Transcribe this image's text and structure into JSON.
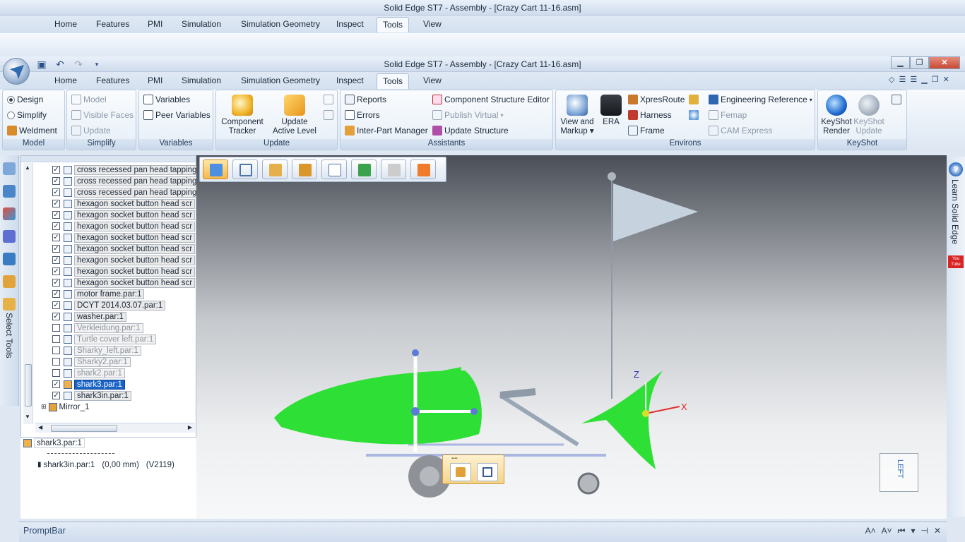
{
  "app": {
    "title": "Solid Edge ST7 - Assembly - [Crazy Cart 11-16.asm]"
  },
  "window_controls": {
    "minimize": "▁",
    "restore": "❐",
    "close": "✕"
  },
  "tabs": [
    "Home",
    "Features",
    "PMI",
    "Simulation",
    "Simulation Geometry",
    "Inspect",
    "Tools",
    "View"
  ],
  "active_tab": "Tools",
  "ribbon": {
    "model": {
      "label": "Model",
      "design": "Design",
      "simplify": "Simplify",
      "weldment": "Weldment"
    },
    "simplify": {
      "label": "Simplify",
      "model": "Model",
      "visible_faces": "Visible Faces",
      "update": "Update"
    },
    "variables": {
      "label": "Variables",
      "variables": "Variables",
      "peer_variables": "Peer Variables"
    },
    "update": {
      "label": "Update",
      "component_tracker": [
        "Component",
        "Tracker"
      ],
      "update_active_level": [
        "Update",
        "Active Level"
      ]
    },
    "assistants": {
      "label": "Assistants",
      "reports": "Reports",
      "errors": "Errors",
      "inter_part_manager": "Inter-Part Manager",
      "component_structure_editor": "Component Structure Editor",
      "publish_virtual": "Publish Virtual",
      "update_structure": "Update Structure"
    },
    "environs": {
      "label": "Environs",
      "view_and_markup": [
        "View and",
        "Markup"
      ],
      "era": "ERA",
      "xpresroute": "XpresRoute",
      "harness": "Harness",
      "frame": "Frame",
      "engineering_reference": "Engineering Reference",
      "femap": "Femap",
      "cam_express": "CAM Express"
    },
    "keyshot": {
      "label": "KeyShot",
      "render": [
        "KeyShot",
        "Render"
      ],
      "update": [
        "KeyShot",
        "Update"
      ]
    }
  },
  "pathfinder": {
    "items": [
      {
        "label": "cross recessed pan head tapping",
        "checked": true,
        "style": "normal"
      },
      {
        "label": "cross recessed pan head tapping",
        "checked": true,
        "style": "normal"
      },
      {
        "label": "cross recessed pan head tapping",
        "checked": true,
        "style": "normal"
      },
      {
        "label": "hexagon socket button head scr",
        "checked": true,
        "style": "normal"
      },
      {
        "label": "hexagon socket button head scr",
        "checked": true,
        "style": "normal"
      },
      {
        "label": "hexagon socket button head scr",
        "checked": true,
        "style": "normal"
      },
      {
        "label": "hexagon socket button head scr",
        "checked": true,
        "style": "normal"
      },
      {
        "label": "hexagon socket button head scr",
        "checked": true,
        "style": "normal"
      },
      {
        "label": "hexagon socket button head scr",
        "checked": true,
        "style": "normal"
      },
      {
        "label": "hexagon socket button head scr",
        "checked": true,
        "style": "normal"
      },
      {
        "label": "hexagon socket button head scr",
        "checked": true,
        "style": "normal"
      },
      {
        "label": "motor frame.par:1",
        "checked": true,
        "style": "normal"
      },
      {
        "label": "DCYT 2014.03.07.par:1",
        "checked": true,
        "style": "normal"
      },
      {
        "label": "washer.par:1",
        "checked": true,
        "style": "normal"
      },
      {
        "label": "Verkleidung.par:1",
        "checked": false,
        "style": "grey"
      },
      {
        "label": "Turtle cover left.par:1",
        "checked": false,
        "style": "grey"
      },
      {
        "label": "Sharky_left.par:1",
        "checked": false,
        "style": "grey"
      },
      {
        "label": "Sharky2.par:1",
        "checked": false,
        "style": "grey"
      },
      {
        "label": "shark2.par:1",
        "checked": false,
        "style": "grey"
      },
      {
        "label": "shark3.par:1",
        "checked": true,
        "style": "sel"
      },
      {
        "label": "shark3in.par:1",
        "checked": true,
        "style": "normal"
      }
    ],
    "mirror": "Mirror_1",
    "selected_name": "shark3.par:1",
    "child": "shark3in.par:1",
    "child_value": "(0,00 mm)",
    "child_version": "(V2119)"
  },
  "left_strip": {
    "select_tools": "Select Tools"
  },
  "right_strip": {
    "learn": "Learn Solid Edge",
    "youtube": "You Tube"
  },
  "viewport": {
    "axis_z": "Z",
    "axis_x": "X",
    "view_cube": "LEFT"
  },
  "promptbar": {
    "title": "PromptBar"
  }
}
